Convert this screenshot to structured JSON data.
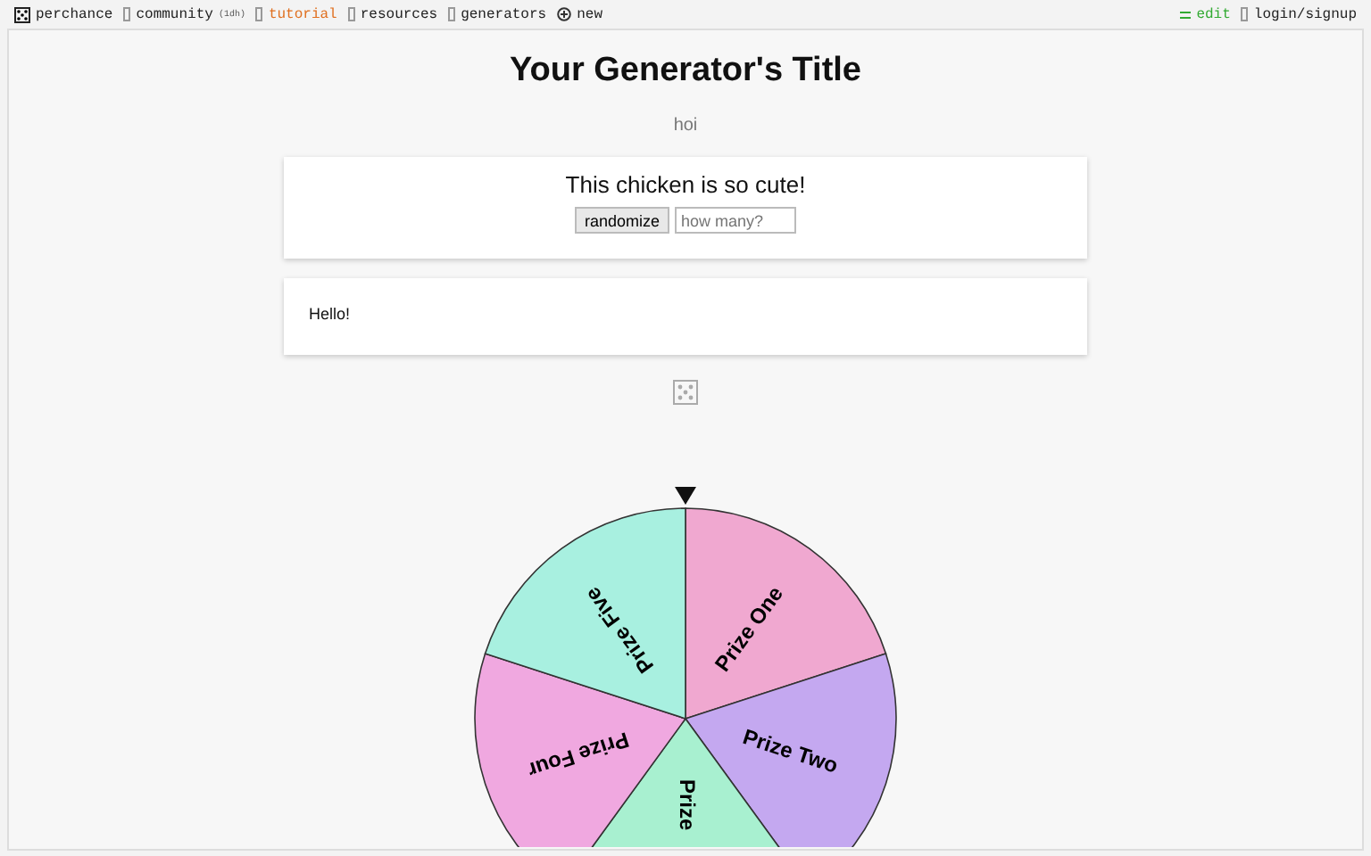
{
  "nav": {
    "left": [
      {
        "kind": "logo",
        "label": "perchance"
      },
      {
        "kind": "link",
        "label": "community",
        "badge": "(1dh)"
      },
      {
        "kind": "active",
        "label": "tutorial"
      },
      {
        "kind": "link",
        "label": "resources"
      },
      {
        "kind": "link",
        "label": "generators"
      },
      {
        "kind": "new",
        "label": "new"
      }
    ],
    "right": [
      {
        "kind": "edit",
        "label": "edit"
      },
      {
        "kind": "link",
        "label": "login/signup"
      }
    ]
  },
  "title": "Your Generator's Title",
  "subtitle": "hoi",
  "output": {
    "text": "This chicken is so cute!",
    "button": "randomize",
    "placeholder": "how many?"
  },
  "note": "Hello!",
  "wheel": {
    "slices": [
      {
        "label": "Prize One",
        "color": "#f0a8d0"
      },
      {
        "label": "Prize Two",
        "color": "#c4a8f0"
      },
      {
        "label": "Prize",
        "color": "#a8f0d0"
      },
      {
        "label": "Prize Four",
        "color": "#f0a8e0"
      },
      {
        "label": "Prize Five",
        "color": "#a8f0e0"
      }
    ]
  }
}
